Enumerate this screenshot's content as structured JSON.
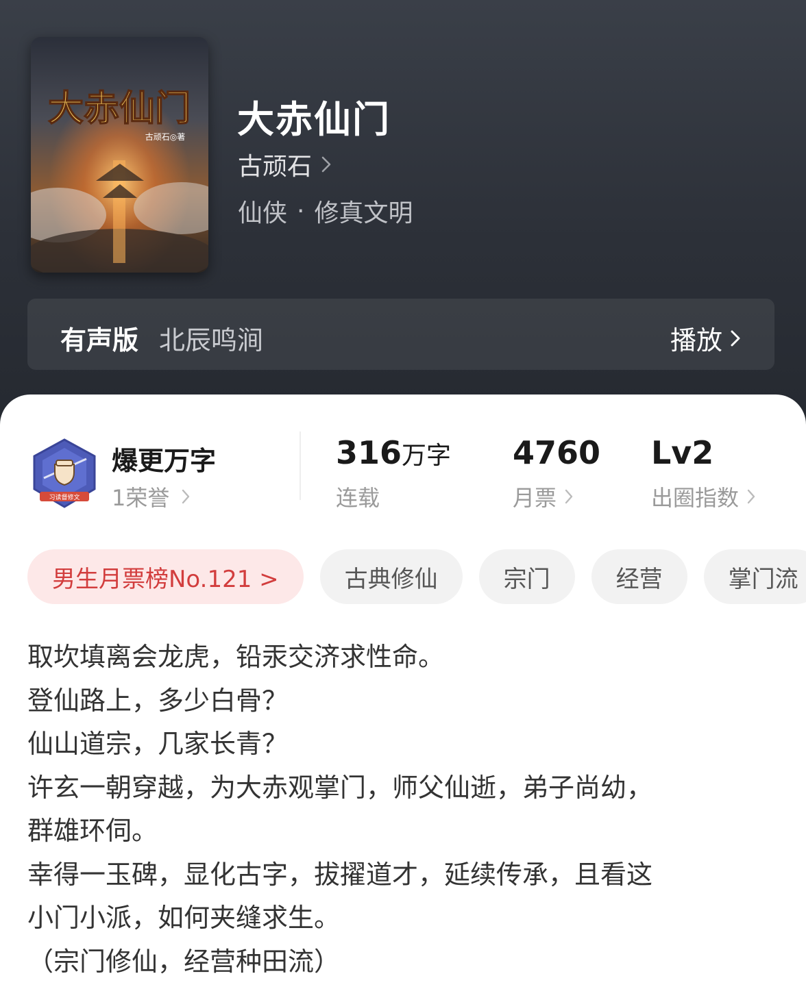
{
  "book": {
    "title": "大赤仙门",
    "author": "古顽石",
    "genre_main": "仙侠",
    "genre_sep": "·",
    "genre_sub": "修真文明",
    "cover": {
      "title_art": "大赤仙门",
      "author_mark": "古顽石◎著"
    }
  },
  "audio": {
    "label": "有声版",
    "narrator": "北辰鸣涧",
    "play_label": "播放"
  },
  "honor": {
    "badge_ribbon": "习读督修文",
    "title": "爆更万字",
    "subtitle": "1荣誉"
  },
  "stats": [
    {
      "value": "316",
      "unit": "万字",
      "label": "连载",
      "has_arrow": false
    },
    {
      "value": "4760",
      "unit": "",
      "label": "月票",
      "has_arrow": true
    },
    {
      "value": "Lv2",
      "unit": "",
      "label": "出圈指数",
      "has_arrow": true
    }
  ],
  "tags": {
    "rank": "男生月票榜No.121 >",
    "items": [
      "古典修仙",
      "宗门",
      "经营",
      "掌门流"
    ]
  },
  "synopsis": [
    "取坎填离会龙虎，铅汞交济求性命。",
    "登仙路上，多少白骨？",
    "仙山道宗，几家长青？",
    "许玄一朝穿越，为大赤观掌门，师父仙逝，弟子尚幼，",
    "群雄环伺。",
    "幸得一玉碑，显化古字，拔擢道才，延续传承，且看这",
    "小门小派，如何夹缝求生。",
    "（宗门修仙，经营种田流）"
  ],
  "colors": {
    "header_bg": "#2c3038",
    "rank_tag_bg": "#fde8e8",
    "rank_tag_text": "#d23d3d",
    "tag_bg": "#f2f2f2"
  }
}
